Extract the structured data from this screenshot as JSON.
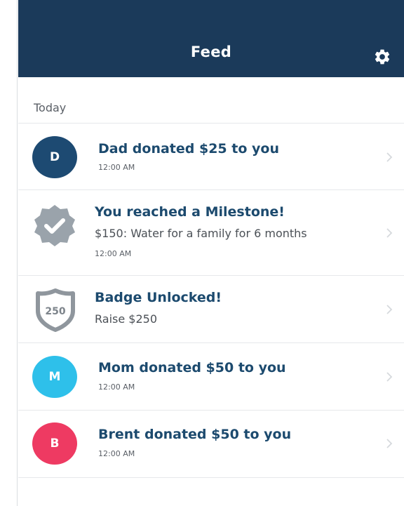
{
  "header": {
    "title": "Feed",
    "settings_icon": "gear-icon"
  },
  "section": {
    "label": "Today"
  },
  "colors": {
    "header_bg": "#1b3a5a",
    "title_text": "#1c4a6e",
    "avatar_dad": "#1d4a72",
    "avatar_mom": "#2ec0ea",
    "avatar_brent": "#ee3a62",
    "milestone_badge": "#9aa3ab",
    "shield_badge": "#8f969d"
  },
  "feed": [
    {
      "type": "donation",
      "avatar_letter": "D",
      "title": "Dad donated $25 to you",
      "time": "12:00 AM"
    },
    {
      "type": "milestone",
      "icon": "check-badge-icon",
      "title": "You reached a Milestone!",
      "subtitle": "$150: Water for a family for 6 months",
      "time": "12:00 AM"
    },
    {
      "type": "badge",
      "icon": "shield-badge-icon",
      "badge_number": "250",
      "title": "Badge Unlocked!",
      "subtitle": "Raise $250"
    },
    {
      "type": "donation",
      "avatar_letter": "M",
      "title": "Mom donated $50 to you",
      "time": "12:00 AM"
    },
    {
      "type": "donation",
      "avatar_letter": "B",
      "title": "Brent donated $50 to you",
      "time": "12:00 AM"
    }
  ]
}
